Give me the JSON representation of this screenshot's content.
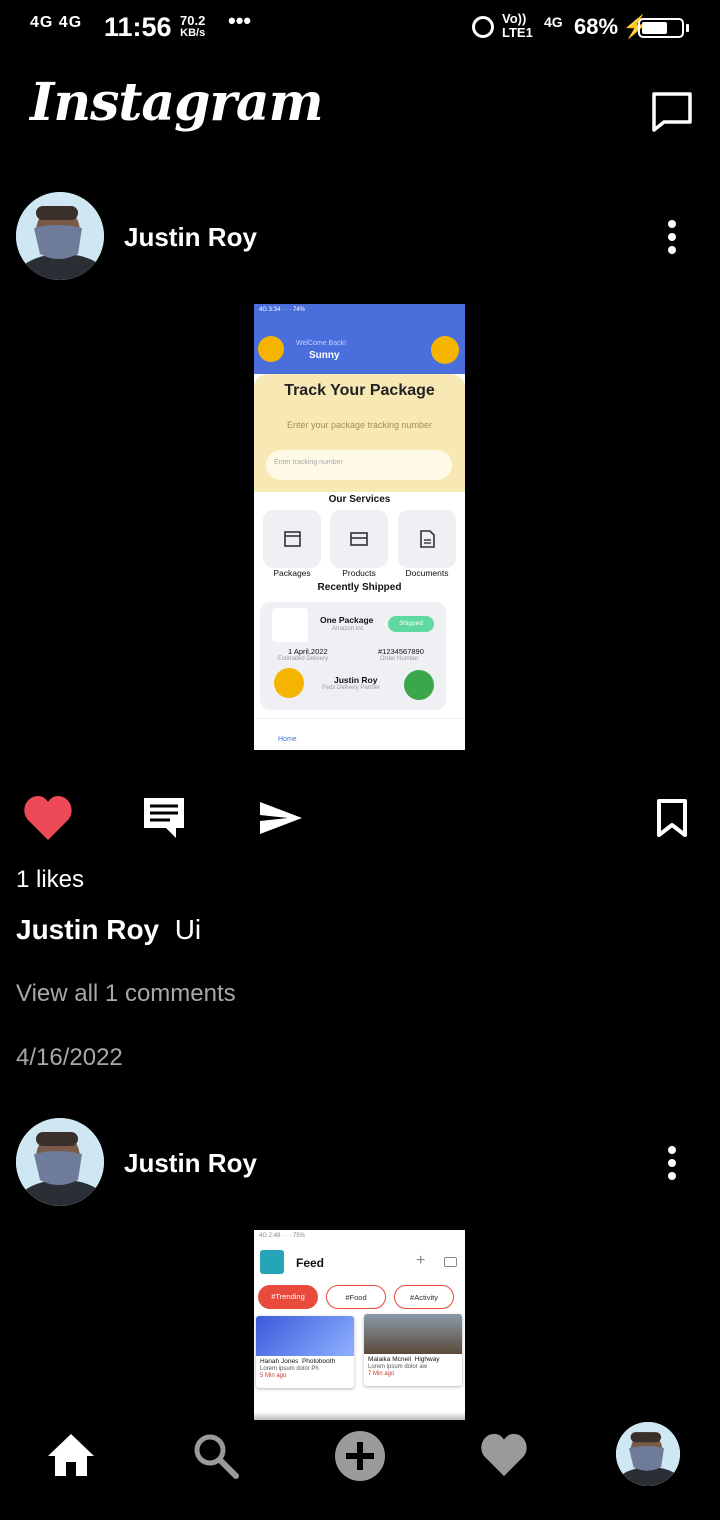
{
  "status_bar": {
    "network": "4G 4G",
    "time": "11:56",
    "speed_value": "70.2",
    "speed_unit": "KB/s",
    "more": "•••",
    "volte_top": "Vo))",
    "volte_bottom": "LTE1",
    "network2": "4G",
    "battery_pct": "68%",
    "battery_level": 0.68
  },
  "app": {
    "logo": "Instagram"
  },
  "posts": [
    {
      "username": "Justin Roy",
      "likes": "1 likes",
      "caption_user": "Justin Roy",
      "caption_text": "Ui",
      "view_comments": "View all 1 comments",
      "date": "4/16/2022",
      "image": {
        "welcome": "WelCome Back!",
        "user": "Sunny",
        "title": "Track Your Package",
        "subtitle": "Enter your package tracking number",
        "input_placeholder": "Enter tracking number",
        "services_heading": "Our Services",
        "services": [
          "Packages",
          "Products",
          "Documents"
        ],
        "recent_heading": "Recently Shipped",
        "package_name": "One Package",
        "package_from": "Amazon.Inc",
        "package_status": "Shipped",
        "delivery_date": "1 April,2022",
        "delivery_label": "Estimated Delivery",
        "order_number": "#1234567890",
        "order_label": "Order Number",
        "driver_name": "Justin Roy",
        "driver_role": "Fedx Delivery Partner",
        "nav_home": "Home"
      }
    },
    {
      "username": "Justin Roy",
      "image": {
        "title": "Feed",
        "chips": [
          "#Trending",
          "#Food",
          "#Activity"
        ],
        "cards": [
          {
            "title": "Hanah Jones",
            "tag": "Photobooth",
            "desc": "Lorem ipsum dolor Ph",
            "time": "5 Min ago"
          },
          {
            "title": "Malaika Mcneil",
            "tag": "Highway",
            "desc": "Lorem ipsum dolor aw",
            "time": "7 Min ago"
          }
        ]
      }
    }
  ],
  "colors": {
    "background": "#000000",
    "like_red": "#ed4956",
    "muted_text": "#a8a8a8",
    "accent_blue": "#4a6fdc",
    "accent_yellow": "#f5b400"
  },
  "icons": {
    "like": "heart-icon",
    "comment": "comment-icon",
    "share": "send-icon",
    "save": "bookmark-icon",
    "messages": "message-icon",
    "more": "kebab-icon",
    "nav": [
      "home-icon",
      "search-icon",
      "add-icon",
      "activity-heart-icon",
      "profile-avatar"
    ]
  }
}
